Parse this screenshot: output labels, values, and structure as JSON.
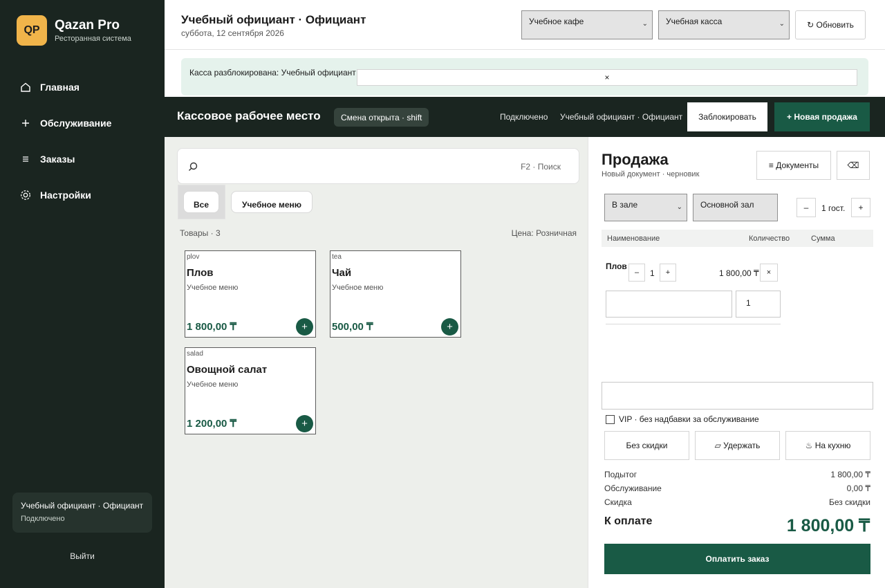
{
  "sidebar": {
    "logo": "QP",
    "brand_name": "Qazan Pro",
    "brand_sub": "Ресторанная система",
    "nav": [
      {
        "label": "Главная",
        "icon": "home-icon"
      },
      {
        "label": "Обслуживание",
        "icon": "plus-icon"
      },
      {
        "label": "Заказы",
        "icon": "list-icon"
      },
      {
        "label": "Настройки",
        "icon": "gear-icon"
      }
    ],
    "user_name": "Учебный официант · Официант",
    "user_status": "Подключено",
    "logout": "Выйти"
  },
  "header": {
    "title": "Учебный официант · Официант",
    "date": "суббота, 12 сентября 2026",
    "cafe_select": "Учебное кафе",
    "register_select": "Учебная касса",
    "refresh": "↻ Обновить"
  },
  "notice": {
    "text": "Касса разблокирована: Учебный официант",
    "close": "×"
  },
  "posbar": {
    "title": "Кассовое рабочее место",
    "shift": "Смена открыта · shift",
    "connection": "Подключено",
    "user": "Учебный официант · Официант",
    "lock": "Заблокировать",
    "new_sale": "+ Новая продажа"
  },
  "catalog": {
    "search_hint": "F2 · Поиск",
    "categories": [
      "Все",
      "Учебное меню"
    ],
    "items_count": "Товары · 3",
    "price_type": "Цена: Розничная",
    "products": [
      {
        "code": "plov",
        "name": "Плов",
        "category": "Учебное меню",
        "price": "1 800,00 ₸"
      },
      {
        "code": "tea",
        "name": "Чай",
        "category": "Учебное меню",
        "price": "500,00 ₸"
      },
      {
        "code": "salad",
        "name": "Овощной салат",
        "category": "Учебное меню",
        "price": "1 200,00 ₸"
      }
    ],
    "add": "+"
  },
  "sale": {
    "title": "Продажа",
    "subtitle": "Новый документ · черновик",
    "documents": "≡ Документы",
    "clear": "⌫",
    "service_type": "В зале",
    "hall": "Основной зал",
    "guests_minus": "–",
    "guests": "1 гост.",
    "guests_plus": "+",
    "columns": {
      "name": "Наименование",
      "qty": "Количество",
      "sum": "Сумма"
    },
    "line": {
      "name": "Плов",
      "minus": "–",
      "qty": "1",
      "plus": "+",
      "sum": "1 800,00 ₸",
      "remove": "×",
      "qty_input": "1"
    },
    "vip": "VIP · без надбавки за обслуживание",
    "no_discount": "Без скидки",
    "hold": "▱ Удержать",
    "to_kitchen": "♨ На кухню",
    "subtotal_label": "Подытог",
    "subtotal": "1 800,00 ₸",
    "service_label": "Обслуживание",
    "service": "0,00 ₸",
    "discount_label": "Скидка",
    "discount": "Без скидки",
    "pay_label": "К оплате",
    "pay_value": "1 800,00 ₸",
    "pay_button": "Оплатить заказ"
  }
}
